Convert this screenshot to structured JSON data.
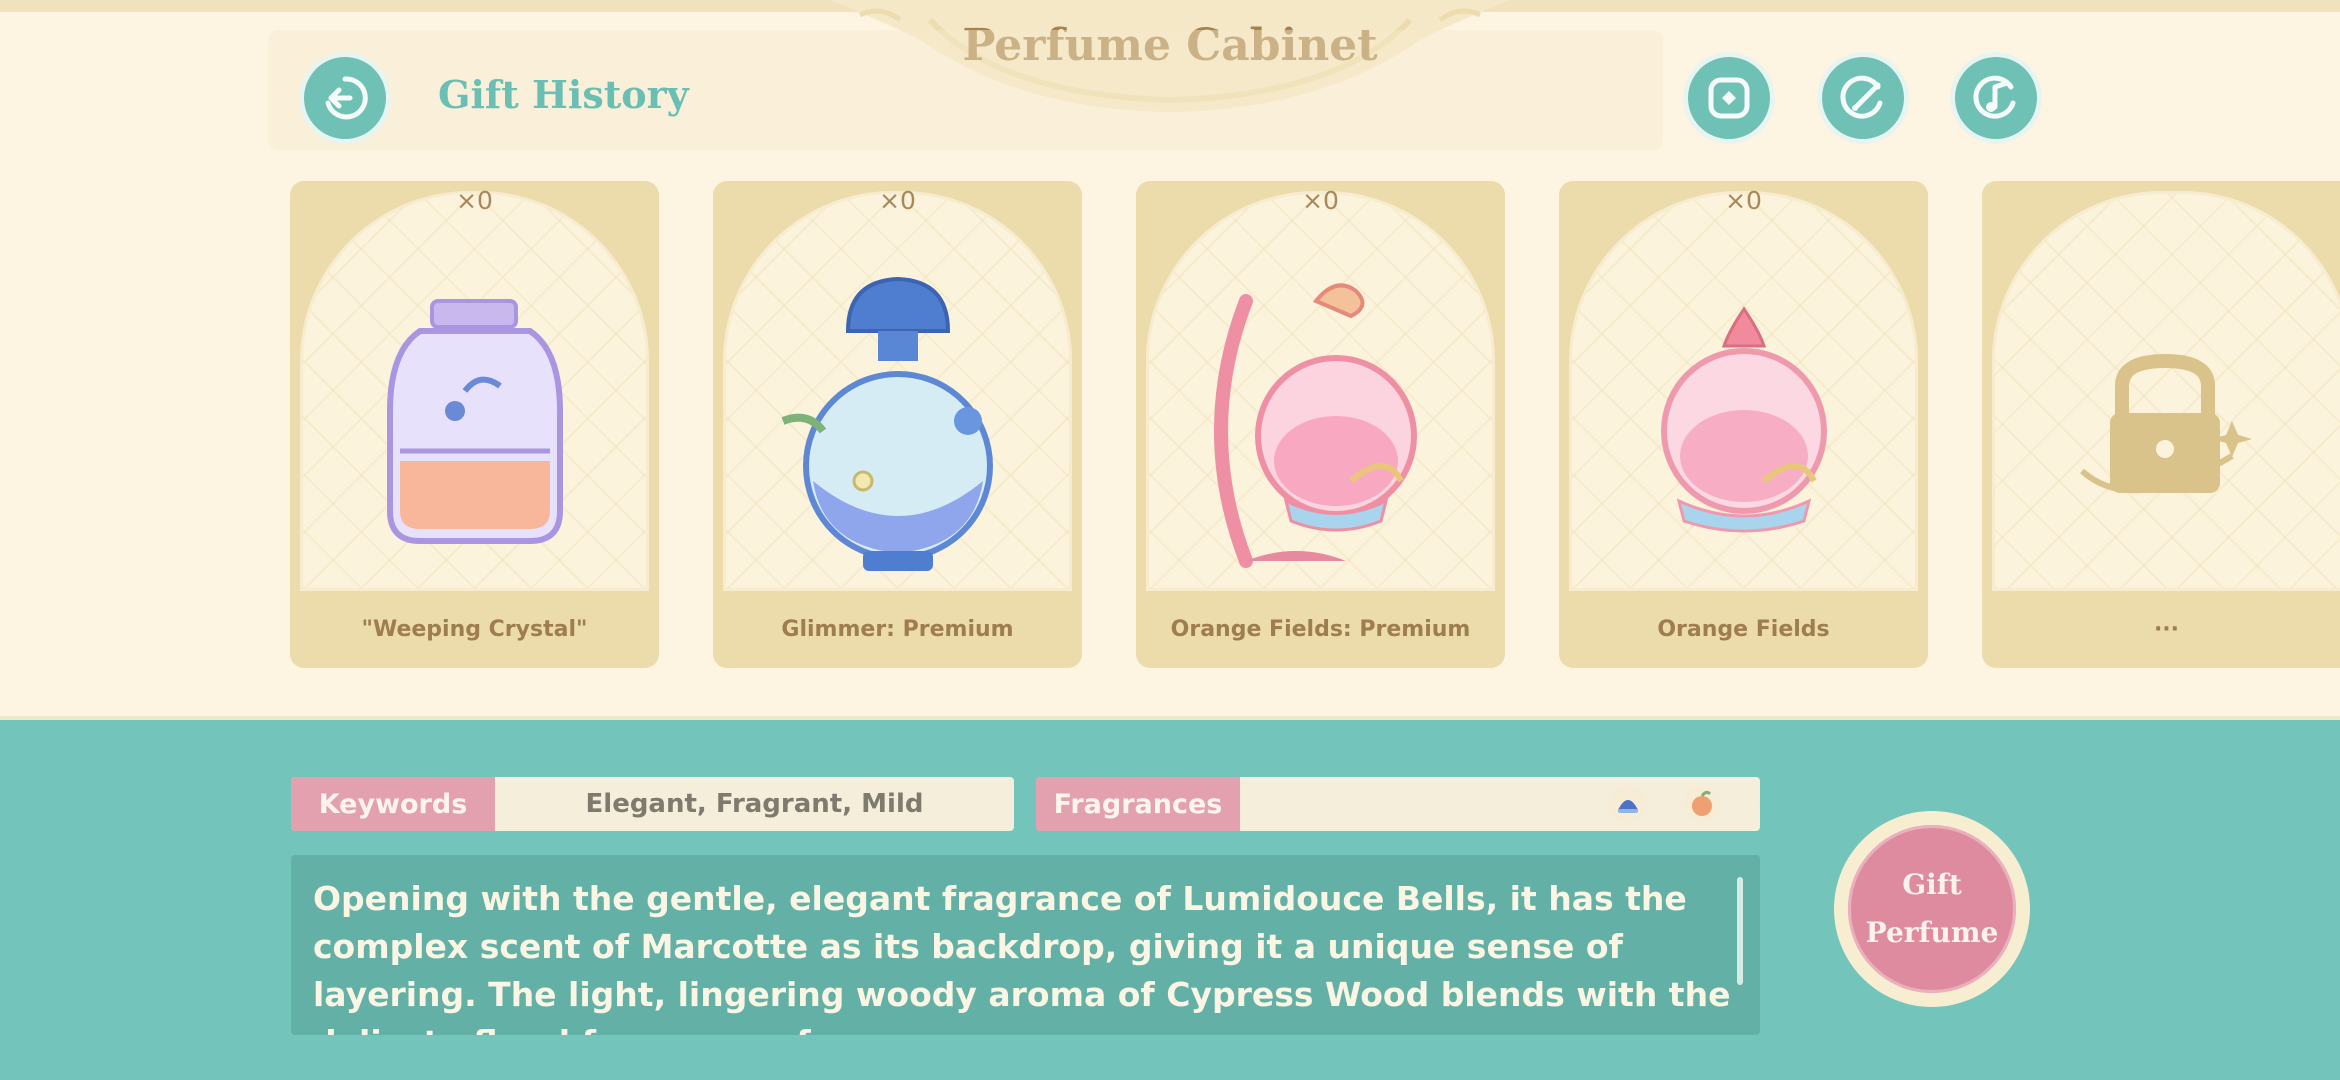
{
  "header": {
    "title": "Perfume Cabinet",
    "subtitle": "Gift History",
    "back_icon": "back-arrow-icon",
    "action_icons": [
      "share-icon",
      "edit-check-icon",
      "music-note-icon"
    ]
  },
  "cards": [
    {
      "count": "×0",
      "label": "\"Weeping Crystal\"",
      "icon": "weeping-crystal-bottle-icon"
    },
    {
      "count": "×0",
      "label": "Glimmer: Premium",
      "icon": "glimmer-premium-bottle-icon"
    },
    {
      "count": "×0",
      "label": "Orange Fields: Premium",
      "icon": "orange-fields-premium-bottle-icon"
    },
    {
      "count": "×0",
      "label": "Orange Fields",
      "icon": "orange-fields-bottle-icon"
    },
    {
      "count": "",
      "label": "···",
      "icon": "lock-icon"
    }
  ],
  "details": {
    "keywords_label": "Keywords",
    "keywords_value": "Elegant, Fragrant, Mild",
    "fragrances_label": "Fragrances",
    "fragrance_icons": [
      "lumidouce-bell-icon",
      "marcotte-icon",
      "cypress-wood-icon"
    ],
    "description": "Opening with the gentle, elegant fragrance of Lumidouce Bells, it has the complex scent of Marcotte as its backdrop, giving it a unique sense of layering. The light, lingering woody aroma of Cypress Wood blends with the delicate floral fragrance of"
  },
  "gift_button": {
    "line1": "Gift",
    "line2": "Perfume"
  },
  "colors": {
    "teal": "#73c4ba",
    "cream": "#fdf5e2",
    "gold": "#a7834b",
    "pink": "#e3a0af"
  }
}
